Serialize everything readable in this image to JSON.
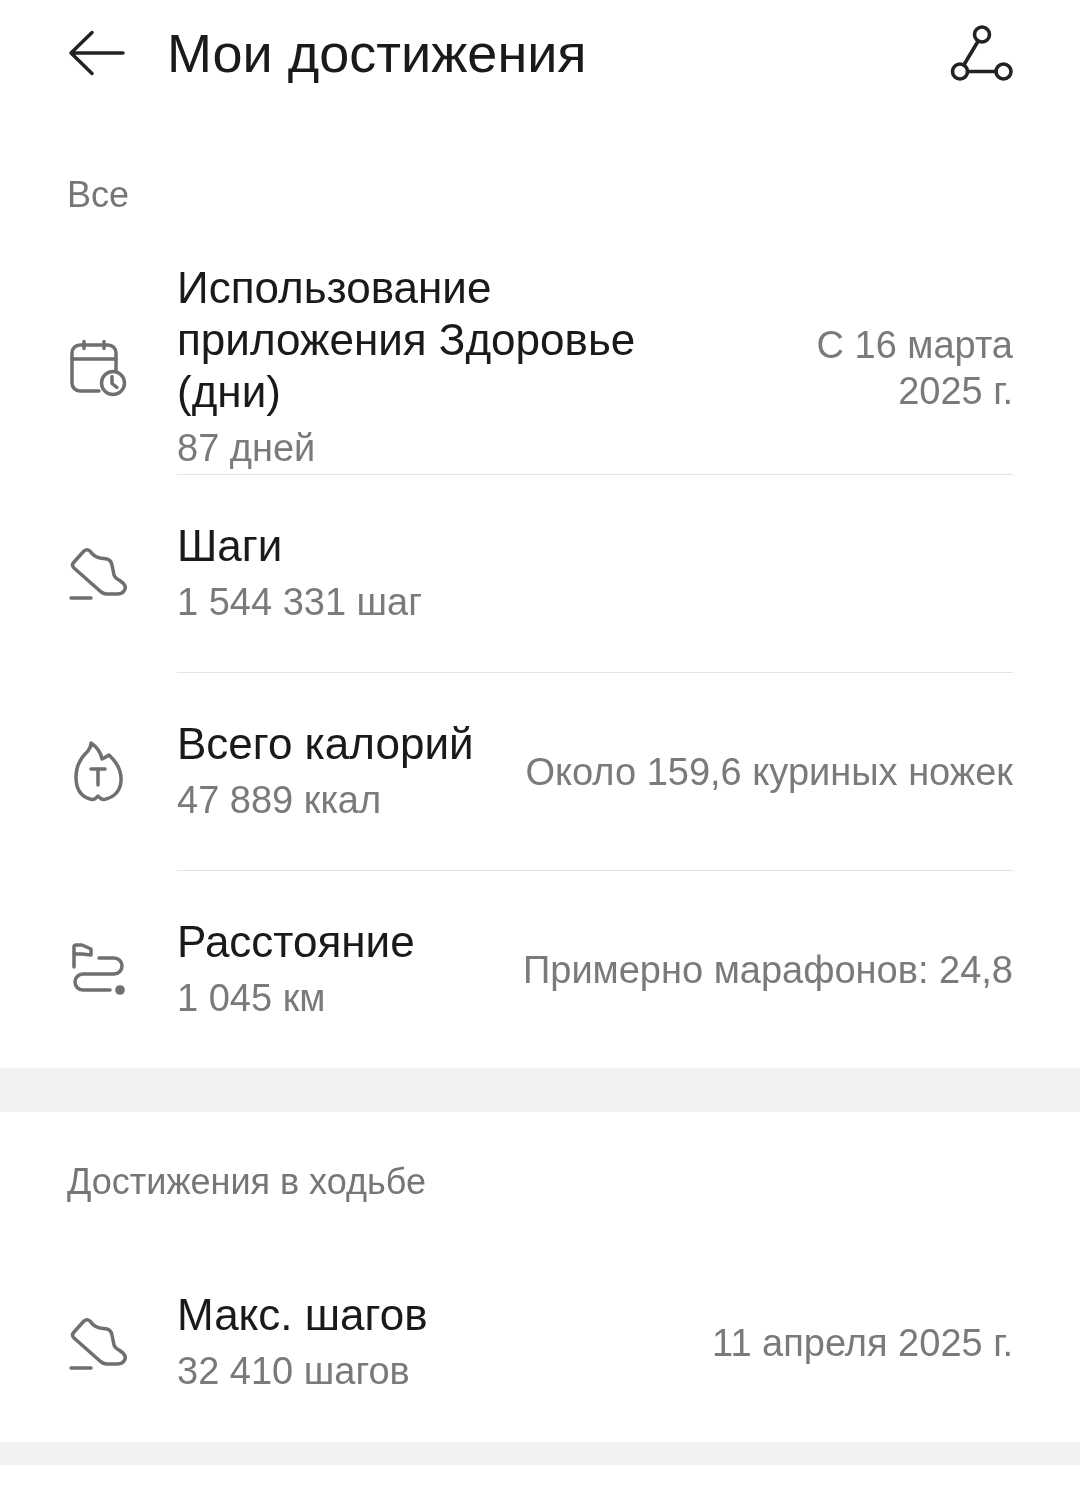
{
  "header": {
    "title": "Мои достижения"
  },
  "sections": [
    {
      "label": "Все",
      "items": [
        {
          "kind": "calendar",
          "title": "Использование приложения Здоровье (дни)",
          "value": "87 дней",
          "note": "С 16 марта 2025 г."
        },
        {
          "kind": "shoe",
          "title": "Шаги",
          "value": "1 544 331 шаг"
        },
        {
          "kind": "flame",
          "title": "Всего калорий",
          "value": "47 889 ккал",
          "note": "Около 159,6 куриных ножек"
        },
        {
          "kind": "route",
          "title": "Расстояние",
          "value": "1 045 км",
          "note": "Примерно марафонов: 24,8"
        }
      ]
    },
    {
      "label": "Достижения в ходьбе",
      "items": [
        {
          "kind": "shoe",
          "title": "Макс. шагов",
          "value": "32 410 шагов",
          "note": "11 апреля 2025 г."
        }
      ]
    }
  ]
}
